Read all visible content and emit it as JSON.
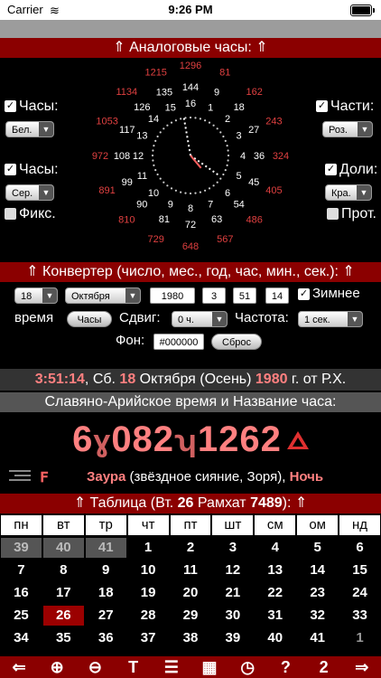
{
  "status": {
    "carrier": "Carrier",
    "time": "9:26 PM"
  },
  "analog": {
    "header": "⇑ Аналоговые часы: ⇑",
    "left": {
      "hours_label": "Часы:",
      "hours_color": "Бел.",
      "hours2_label": "Часы:",
      "hours2_color": "Сер.",
      "fix_label": "Фикс."
    },
    "right": {
      "parts_label": "Части:",
      "parts_color": "Роз.",
      "shares_label": "Доли:",
      "shares_color": "Кра.",
      "prot_label": "Прот."
    },
    "outer_ring": [
      "1296",
      "81",
      "162",
      "243",
      "324",
      "405",
      "486",
      "567",
      "648",
      "729",
      "810",
      "891",
      "972",
      "1053",
      "1134",
      "1215"
    ],
    "middle_ring": [
      "144",
      "9",
      "18",
      "27",
      "36",
      "45",
      "54",
      "63",
      "72",
      "81",
      "90",
      "99",
      "108",
      "117",
      "126",
      "135"
    ],
    "inner_ring": [
      "16",
      "1",
      "2",
      "3",
      "4",
      "5",
      "6",
      "7",
      "8",
      "9",
      "10",
      "11",
      "12",
      "13",
      "14",
      "15"
    ]
  },
  "converter": {
    "header": "⇑ Конвертер (число, мес., год, час, мин., сек.): ⇑",
    "day": "18",
    "month": "Октября",
    "year": "1980",
    "hour": "3",
    "min": "51",
    "sec": "14",
    "winter_label": "Зимнее",
    "time_label": "время",
    "hours_btn": "Часы",
    "shift_label": "Сдвиг:",
    "shift_value": "0 ч.",
    "freq_label": "Частота:",
    "freq_value": "1 сек.",
    "bg_label": "Фон:",
    "bg_value": "#000000",
    "reset_btn": "Сброс"
  },
  "date_line": {
    "time": "3:51:14",
    "rest1": ", Сб. ",
    "day": "18",
    "rest2": " Октября (Осень) ",
    "year": "1980",
    "rest3": " г. от Р.Х."
  },
  "slav": {
    "header": "Славяно-Арийское время и Название часа:",
    "d1": "6",
    "g1": "ɣ",
    "d2": "082",
    "g2": "ʮ",
    "d3": "1262",
    "hour_name": "Заура",
    "hour_desc": " (звёздное сияние, Зоря), ",
    "period": "Ночь"
  },
  "table": {
    "header_pre": "⇑ Таблица (Вт. ",
    "week": "26",
    "mid": " Рамхат ",
    "year": "7489",
    "post": "): ⇑",
    "days": [
      "пн",
      "вт",
      "тр",
      "чт",
      "пт",
      "шт",
      "см",
      "ом",
      "нд"
    ],
    "rows": [
      [
        "39",
        "40",
        "41",
        "1",
        "2",
        "3",
        "4",
        "5",
        "6"
      ],
      [
        "7",
        "8",
        "9",
        "10",
        "11",
        "12",
        "13",
        "14",
        "15"
      ],
      [
        "16",
        "17",
        "18",
        "19",
        "20",
        "21",
        "22",
        "23",
        "24"
      ],
      [
        "25",
        "26",
        "27",
        "28",
        "29",
        "30",
        "31",
        "32",
        "33"
      ],
      [
        "34",
        "35",
        "36",
        "37",
        "38",
        "39",
        "40",
        "41",
        "1"
      ]
    ]
  },
  "toolbar": [
    "⇐",
    "⊕",
    "⊖",
    "T",
    "☰",
    "▦",
    "◷",
    "?",
    "2",
    "⇒"
  ],
  "colors": {
    "accent": "#8b0000",
    "date_red": "#ff8080"
  }
}
